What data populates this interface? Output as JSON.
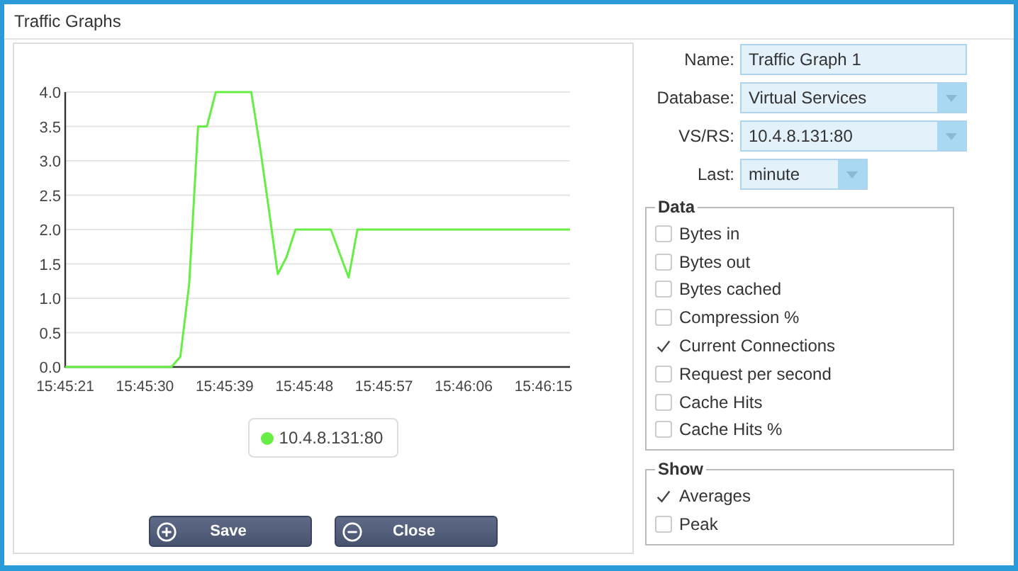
{
  "window": {
    "title": "Traffic Graphs"
  },
  "chart": {
    "chart_data": {
      "type": "line",
      "categories": [
        "15:45:21",
        null,
        null,
        null,
        null,
        null,
        null,
        null,
        null,
        "15:45:30",
        null,
        null,
        null,
        null,
        null,
        null,
        null,
        null,
        "15:45:39",
        null,
        null,
        null,
        null,
        null,
        null,
        null,
        null,
        "15:45:48",
        null,
        null,
        null,
        null,
        null,
        null,
        null,
        null,
        "15:45:57",
        null,
        null,
        null,
        null,
        null,
        null,
        null,
        null,
        "15:46:06",
        null,
        null,
        null,
        null,
        null,
        null,
        null,
        null,
        "15:46:15",
        null,
        null,
        null
      ],
      "series": [
        {
          "name": "10.4.8.131:80",
          "color": "#66ee44",
          "values": [
            0,
            0,
            0,
            0,
            0,
            0,
            0,
            0,
            0,
            0,
            0,
            0,
            0,
            0.15,
            1.2,
            3.5,
            3.5,
            4,
            4,
            4,
            4,
            4,
            3.2,
            2.3,
            1.35,
            1.6,
            2,
            2,
            2,
            2,
            2,
            1.65,
            1.3,
            2,
            2,
            2,
            2,
            2,
            2,
            2,
            2,
            2,
            2,
            2,
            2,
            2,
            2,
            2,
            2,
            2,
            2,
            2,
            2,
            2,
            2,
            2,
            2,
            2
          ]
        }
      ],
      "ylim": [
        0,
        4
      ],
      "grid": true,
      "yticks": [
        {
          "value": 0,
          "label": "0.0"
        },
        {
          "value": 0.5,
          "label": "0.5"
        },
        {
          "value": 1,
          "label": "1.0"
        },
        {
          "value": 1.5,
          "label": "1.5"
        },
        {
          "value": 2,
          "label": "2.0"
        },
        {
          "value": 2.5,
          "label": "2.5"
        },
        {
          "value": 3,
          "label": "3.0"
        },
        {
          "value": 3.5,
          "label": "3.5"
        },
        {
          "value": 4,
          "label": "4.0"
        }
      ]
    }
  },
  "buttons": [
    {
      "kind": "add",
      "label": "Save"
    },
    {
      "kind": "remove",
      "label": "Close"
    }
  ],
  "form": {
    "fields": [
      {
        "kind": "text",
        "label": "Name:",
        "value": "Traffic Graph 1"
      },
      {
        "kind": "select",
        "label": "Database:",
        "value": "Virtual Services"
      },
      {
        "kind": "select",
        "label": "VS/RS:",
        "value": "10.4.8.131:80"
      },
      {
        "kind": "small-select",
        "label": "Last:",
        "value": "minute"
      }
    ]
  },
  "groups": [
    {
      "title": "Data",
      "items": [
        {
          "label": "Bytes in",
          "checked": false
        },
        {
          "label": "Bytes out",
          "checked": false
        },
        {
          "label": "Bytes cached",
          "checked": false
        },
        {
          "label": "Compression %",
          "checked": false
        },
        {
          "label": "Current Connections",
          "checked": true
        },
        {
          "label": "Request per second",
          "checked": false
        },
        {
          "label": "Cache Hits",
          "checked": false
        },
        {
          "label": "Cache Hits %",
          "checked": false
        }
      ]
    },
    {
      "title": "Show",
      "items": [
        {
          "label": "Averages",
          "checked": true
        },
        {
          "label": "Peak",
          "checked": false
        }
      ]
    }
  ]
}
